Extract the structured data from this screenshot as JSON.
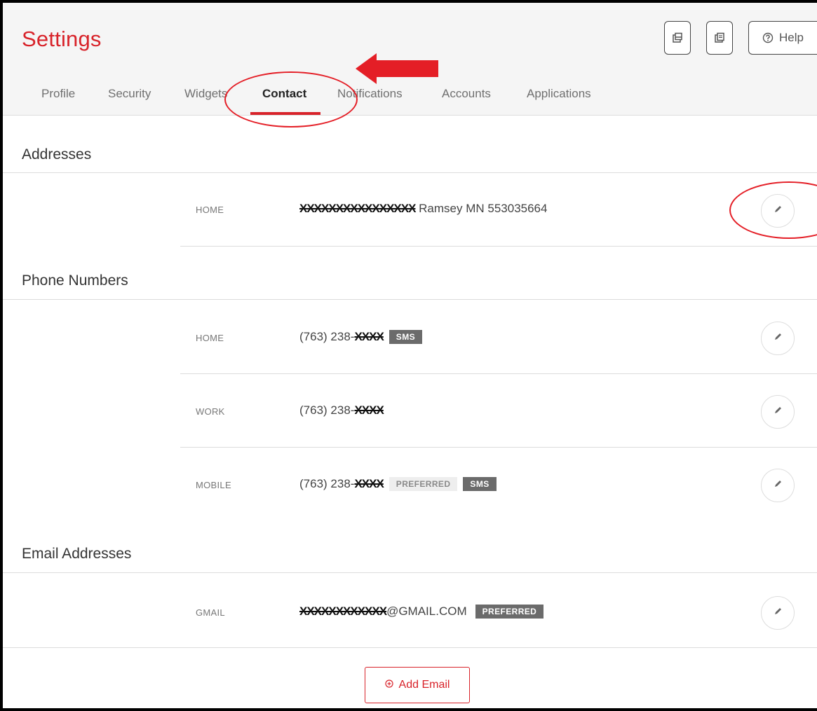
{
  "header": {
    "title": "Settings",
    "help_label": "Help",
    "icons": [
      "window-icon",
      "document-icon",
      "help-circle-icon"
    ]
  },
  "tabs": [
    {
      "label": "Profile",
      "active": false
    },
    {
      "label": "Security",
      "active": false
    },
    {
      "label": "Widgets",
      "active": false
    },
    {
      "label": "Contact",
      "active": true
    },
    {
      "label": "Notifications",
      "active": false
    },
    {
      "label": "Accounts",
      "active": false
    },
    {
      "label": "Applications",
      "active": false
    }
  ],
  "addresses": {
    "title": "Addresses",
    "items": [
      {
        "label": "HOME",
        "redacted": "XXXXXXXXXXXXXXXX",
        "value": " Ramsey MN 553035664"
      }
    ]
  },
  "phones": {
    "title": "Phone Numbers",
    "items": [
      {
        "label": "HOME",
        "prefix": "(763) 238-",
        "redacted": "XXXX",
        "badges": [
          "SMS"
        ]
      },
      {
        "label": "WORK",
        "prefix": "(763) 238-",
        "redacted": "XXXX",
        "badges": []
      },
      {
        "label": "MOBILE",
        "prefix": "(763) 238-",
        "redacted": "XXXX",
        "badges": [
          "PREFERRED",
          "SMS"
        ]
      }
    ]
  },
  "emails": {
    "title": "Email Addresses",
    "items": [
      {
        "label": "GMAIL",
        "redacted": "XXXXXXXXXXXX",
        "suffix": "@GMAIL.COM",
        "badges": [
          "PREFERRED"
        ]
      }
    ],
    "add_label": "Add Email"
  },
  "badges": {
    "sms": "SMS",
    "preferred": "PREFERRED"
  },
  "colors": {
    "brand": "#d8232a",
    "annotation": "#e41e26",
    "badge_dark": "#6b6b6b"
  }
}
